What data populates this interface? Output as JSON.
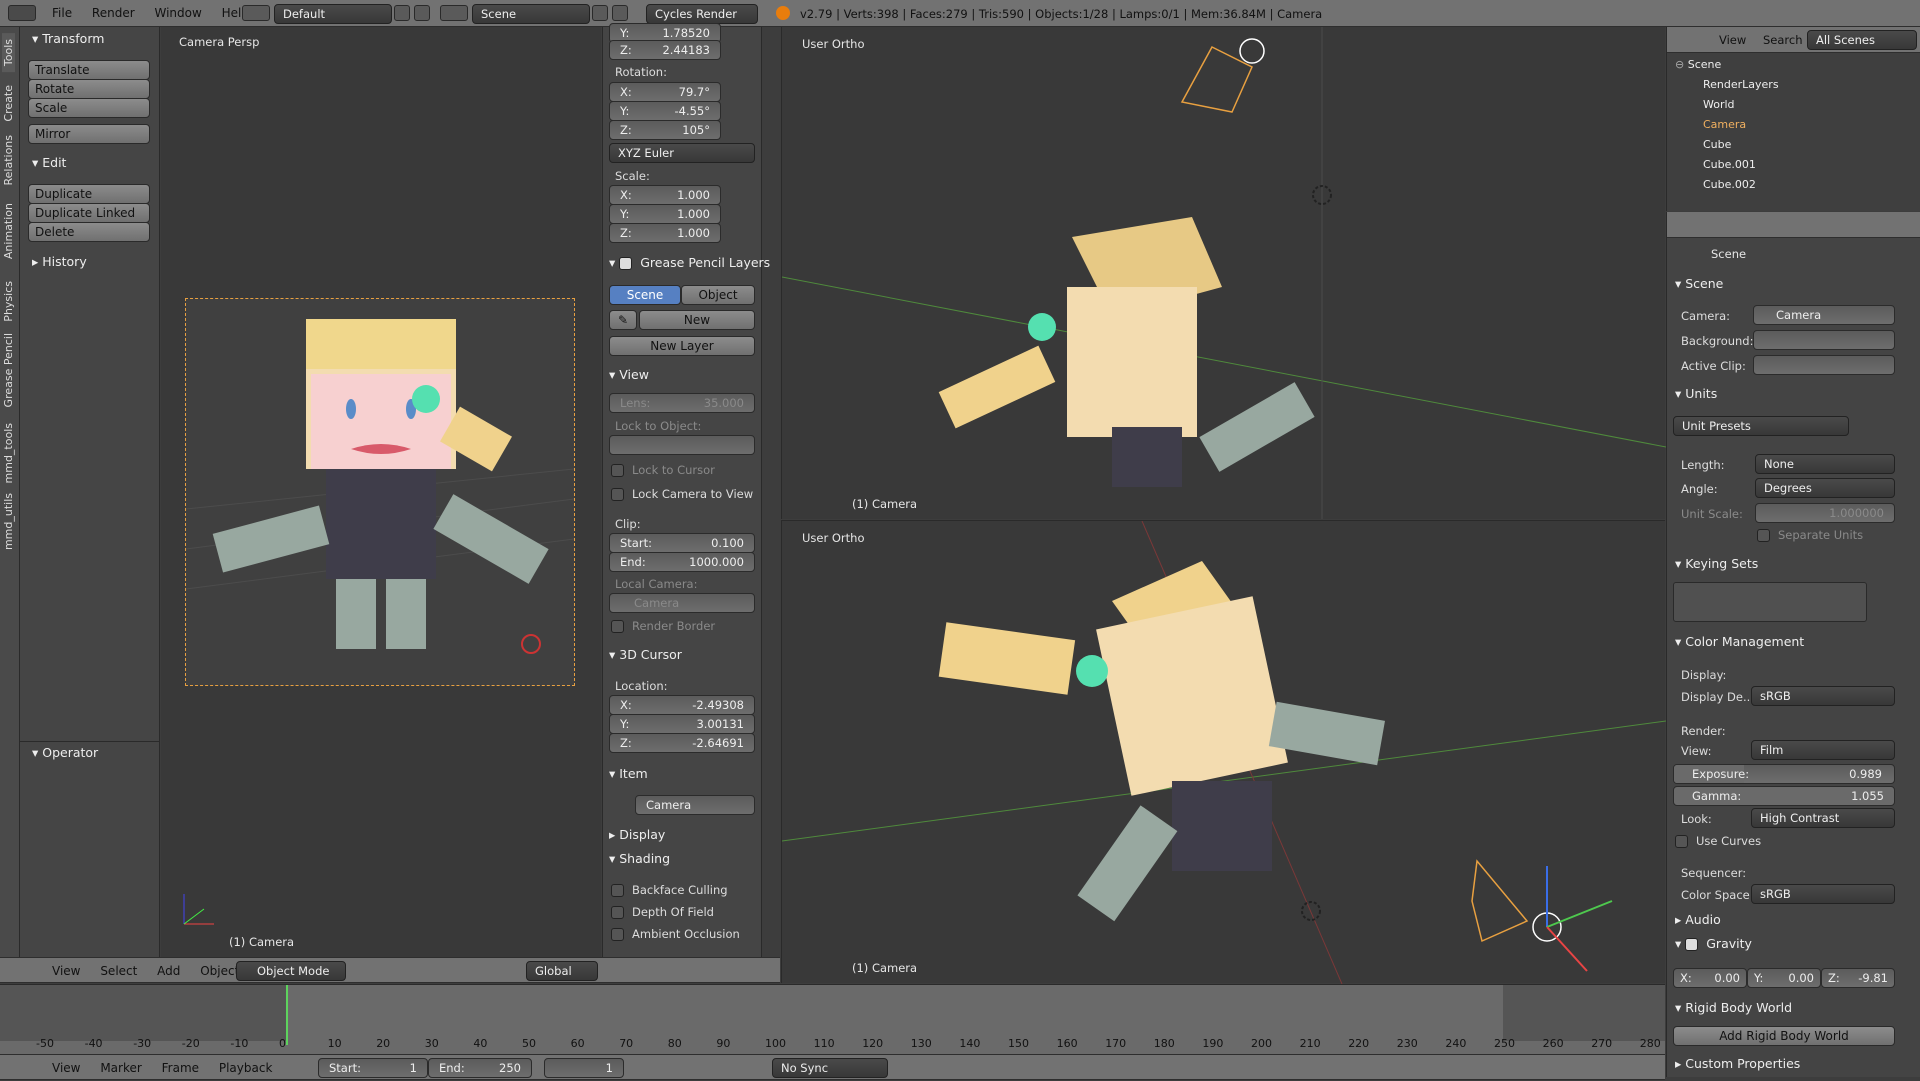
{
  "top": {
    "menu": [
      "File",
      "Render",
      "Window",
      "Help"
    ],
    "layout": "Default",
    "scene": "Scene",
    "engine": "Cycles Render",
    "stats": "v2.79 | Verts:398 | Faces:279 | Tris:590 | Objects:1/28 | Lamps:0/1 | Mem:36.84M | Camera"
  },
  "toolshelf": {
    "tabs": [
      "Tools",
      "Create",
      "Relations",
      "Animation",
      "Physics",
      "Grease Pencil",
      "mmd_tools",
      "mmd_utils"
    ],
    "transform": "Transform",
    "transform_btns": [
      "Translate",
      "Rotate",
      "Scale"
    ],
    "mirror": "Mirror",
    "edit": "Edit",
    "edit_btns": [
      "Duplicate",
      "Duplicate Linked",
      "Delete"
    ],
    "history": "History",
    "operator": "Operator"
  },
  "leftview": {
    "title": "Camera Persp",
    "footer": "(1) Camera"
  },
  "props": {
    "loc_y": "Y:",
    "loc_y_val": "1.78520",
    "loc_z": "Z:",
    "loc_z_val": "2.44183",
    "rotation": "Rotation:",
    "rot": [
      {
        "k": "X:",
        "v": "79.7°"
      },
      {
        "k": "Y:",
        "v": "-4.55°"
      },
      {
        "k": "Z:",
        "v": "105°"
      }
    ],
    "euler": "XYZ Euler",
    "scale": "Scale:",
    "sca": [
      {
        "k": "X:",
        "v": "1.000"
      },
      {
        "k": "Y:",
        "v": "1.000"
      },
      {
        "k": "Z:",
        "v": "1.000"
      }
    ],
    "gp": "Grease Pencil Layers",
    "gp_scene": "Scene",
    "gp_object": "Object",
    "gp_new": "New",
    "gp_newlayer": "New Layer",
    "view": "View",
    "lens": "Lens:",
    "lens_val": "35.000",
    "lock_obj": "Lock to Object:",
    "lock_cursor": "Lock to Cursor",
    "lock_cam": "Lock Camera to View",
    "clip": "Clip:",
    "start": "Start:",
    "start_val": "0.100",
    "end": "End:",
    "end_val": "1000.000",
    "local_cam": "Local Camera:",
    "local_cam_val": "Camera",
    "render_border": "Render Border",
    "cursor": "3D Cursor",
    "location": "Location:",
    "cur": [
      {
        "k": "X:",
        "v": "-2.49308"
      },
      {
        "k": "Y:",
        "v": "3.00131"
      },
      {
        "k": "Z:",
        "v": "-2.64691"
      }
    ],
    "item": "Item",
    "item_name": "Camera",
    "display": "Display",
    "shading": "Shading",
    "backface": "Backface Culling",
    "dof": "Depth Of Field",
    "ao": "Ambient Occlusion"
  },
  "viewheader": {
    "menus": [
      "View",
      "Select",
      "Add",
      "Object"
    ],
    "mode": "Object Mode",
    "orient": "Global"
  },
  "topright": {
    "title": "User Ortho",
    "footer": "(1) Camera"
  },
  "bottomright": {
    "title": "User Ortho",
    "footer": "(1) Camera"
  },
  "outliner": {
    "menus": [
      "View",
      "Search"
    ],
    "scope": "All Scenes",
    "items": [
      "Scene",
      "RenderLayers",
      "World",
      "Camera",
      "Cube",
      "Cube.001",
      "Cube.002"
    ]
  },
  "properties": {
    "context": "Scene",
    "scene_panel": "Scene",
    "camera_lbl": "Camera:",
    "camera_val": "Camera",
    "background_lbl": "Background:",
    "clip_lbl": "Active Clip:",
    "units": "Units",
    "unit_presets": "Unit Presets",
    "length_lbl": "Length:",
    "length_val": "None",
    "angle_lbl": "Angle:",
    "angle_val": "Degrees",
    "unitscale_lbl": "Unit Scale:",
    "unitscale_val": "1.000000",
    "separate": "Separate Units",
    "keying": "Keying Sets",
    "cm": "Color Management",
    "display_lbl": "Display:",
    "displaydev_lbl": "Display De...",
    "displaydev_val": "sRGB",
    "render_lbl": "Render:",
    "view_lbl": "View:",
    "view_val": "Film",
    "exposure_lbl": "Exposure:",
    "exposure_val": "0.989",
    "exposure_fill": 0.32,
    "gamma_lbl": "Gamma:",
    "gamma_val": "1.055",
    "look_lbl": "Look:",
    "look_val": "High Contrast",
    "curves": "Use Curves",
    "seq_lbl": "Sequencer:",
    "colorspace_lbl": "Color Space:",
    "colorspace_val": "sRGB",
    "audio": "Audio",
    "gravity": "Gravity",
    "gx": "X:",
    "gx_val": "0.00",
    "gy": "Y:",
    "gy_val": "0.00",
    "gz": "Z:",
    "gz_val": "-9.81",
    "rbw": "Rigid Body World",
    "add_rbw": "Add Rigid Body World",
    "custom": "Custom Properties"
  },
  "timeline": {
    "ticks": [
      "-50",
      "-40",
      "-30",
      "-20",
      "-10",
      "0",
      "10",
      "20",
      "30",
      "40",
      "50",
      "60",
      "70",
      "80",
      "90",
      "100",
      "110",
      "120",
      "130",
      "140",
      "150",
      "160",
      "170",
      "180",
      "190",
      "200",
      "210",
      "220",
      "230",
      "240",
      "250",
      "260",
      "270",
      "280"
    ],
    "menus": [
      "View",
      "Marker",
      "Frame",
      "Playback"
    ],
    "start_lbl": "Start:",
    "start_val": "1",
    "end_lbl": "End:",
    "end_val": "250",
    "current": "1",
    "sync": "No Sync"
  }
}
